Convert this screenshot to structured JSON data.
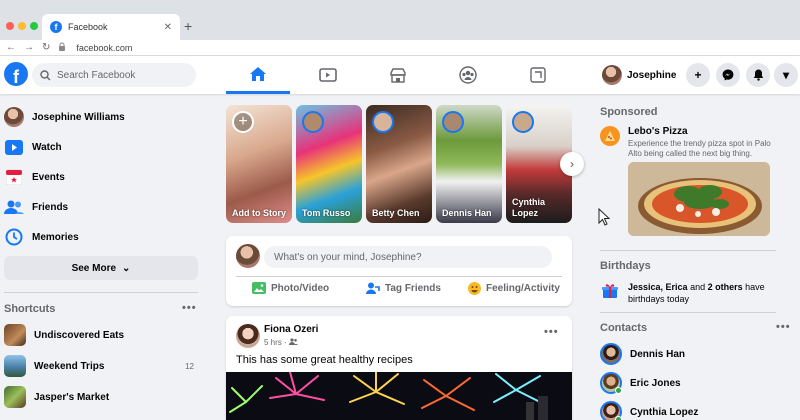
{
  "browser": {
    "tab_title": "Facebook",
    "tab_close": "✕",
    "new_tab": "+",
    "url": "facebook.com",
    "traffic_colors": [
      "#ff5f57",
      "#febc2e",
      "#28c840"
    ]
  },
  "header": {
    "logo": "f",
    "search_placeholder": "Search Facebook",
    "nav_tabs": [
      "home-icon",
      "watch-icon",
      "marketplace-icon",
      "groups-icon",
      "gaming-icon"
    ],
    "profile_name": "Josephine",
    "plus": "+",
    "menu": "▾"
  },
  "left": {
    "profile_name": "Josephine Williams",
    "items": [
      "Watch",
      "Events",
      "Friends",
      "Memories"
    ],
    "see_more": "See More",
    "see_more_chevron": "⌄",
    "shortcuts_title": "Shortcuts",
    "more_dots": "•••",
    "shortcuts": [
      {
        "label": "Undiscovered Eats",
        "badge": ""
      },
      {
        "label": "Weekend Trips",
        "badge": "12"
      },
      {
        "label": "Jasper's Market",
        "badge": ""
      }
    ]
  },
  "stories": {
    "items": [
      "Add to Story",
      "Tom Russo",
      "Betty Chen",
      "Dennis Han",
      "Cynthia Lopez"
    ],
    "plus": "+",
    "next": "›"
  },
  "composer": {
    "placeholder": "What's on your mind, Josephine?",
    "actions": [
      "Photo/Video",
      "Tag Friends",
      "Feeling/Activity"
    ]
  },
  "post": {
    "author": "Fiona Ozeri",
    "time": "5 hrs · ",
    "text": "This has some great healthy recipes",
    "more_dots": "•••"
  },
  "sponsored": {
    "title": "Sponsored",
    "name": "Lebo's Pizza",
    "description": "Experience the trendy pizza spot in Palo Alto being called the next big thing."
  },
  "birthdays": {
    "title": "Birthdays",
    "names": "Jessica, Erica",
    "connector": " and ",
    "others": "2 others",
    "suffix": " have birthdays today"
  },
  "contacts": {
    "title": "Contacts",
    "more_dots": "•••",
    "items": [
      "Dennis Han",
      "Eric Jones",
      "Cynthia Lopez"
    ]
  },
  "colors": {
    "brand": "#1877f2",
    "online": "#31a24c"
  }
}
